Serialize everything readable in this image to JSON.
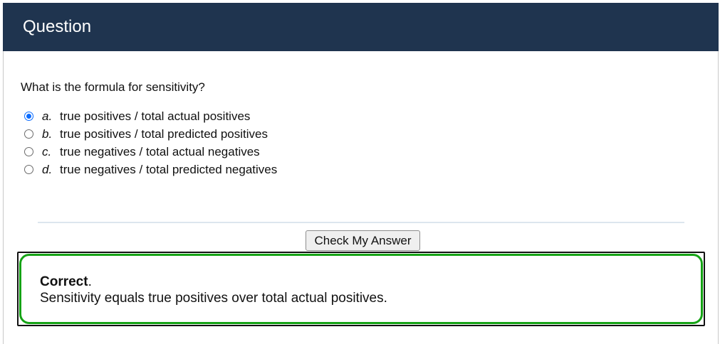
{
  "header": {
    "title": "Question",
    "background_color": "#1f344f"
  },
  "question": {
    "text": "What is the formula for sensitivity?"
  },
  "options": [
    {
      "letter": "a.",
      "text": "true positives / total actual positives",
      "checked": true
    },
    {
      "letter": "b.",
      "text": "true positives / total predicted positives",
      "checked": false
    },
    {
      "letter": "c.",
      "text": "true negatives / total actual negatives",
      "checked": false
    },
    {
      "letter": "d.",
      "text": "true negatives / total predicted negatives",
      "checked": false
    }
  ],
  "check_button": {
    "label": "Check My Answer"
  },
  "feedback": {
    "status": "Correct",
    "status_suffix": ".",
    "message": "Sensitivity equals true positives over total actual positives.",
    "border_color": "#15a315"
  }
}
